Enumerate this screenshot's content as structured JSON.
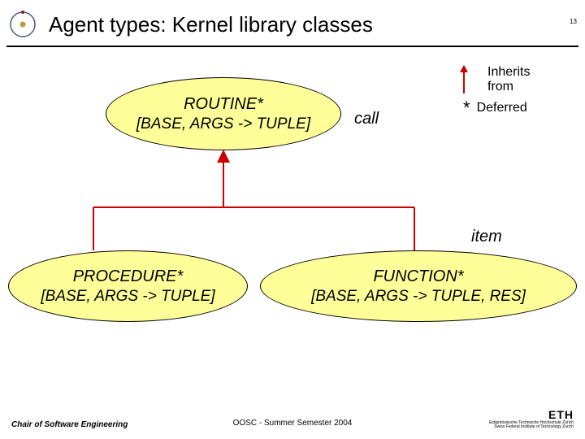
{
  "title": "Agent types: Kernel library classes",
  "page_number": "13",
  "legend": {
    "inherits_label": "Inherits\nfrom",
    "deferred_symbol": "*",
    "deferred_label": "Deferred"
  },
  "classes": {
    "routine": {
      "name": "ROUTINE*",
      "params": "[BASE, ARGS -> TUPLE]",
      "feature": "call"
    },
    "procedure": {
      "name": "PROCEDURE*",
      "params": "[BASE, ARGS -> TUPLE]"
    },
    "function": {
      "name": "FUNCTION*",
      "params": "[BASE, ARGS -> TUPLE, RES]",
      "feature": "item"
    }
  },
  "footer": {
    "left": "Chair of Software Engineering",
    "center": "OOSC - Summer Semester 2004",
    "right_main": "ETH",
    "right_sub": "Eidgenössische Technische Hochschule Zürich\nSwiss Federal Institute of Technology Zurich"
  },
  "colors": {
    "ellipse_fill": "#FFFF99",
    "arrow": "#cc0000"
  }
}
